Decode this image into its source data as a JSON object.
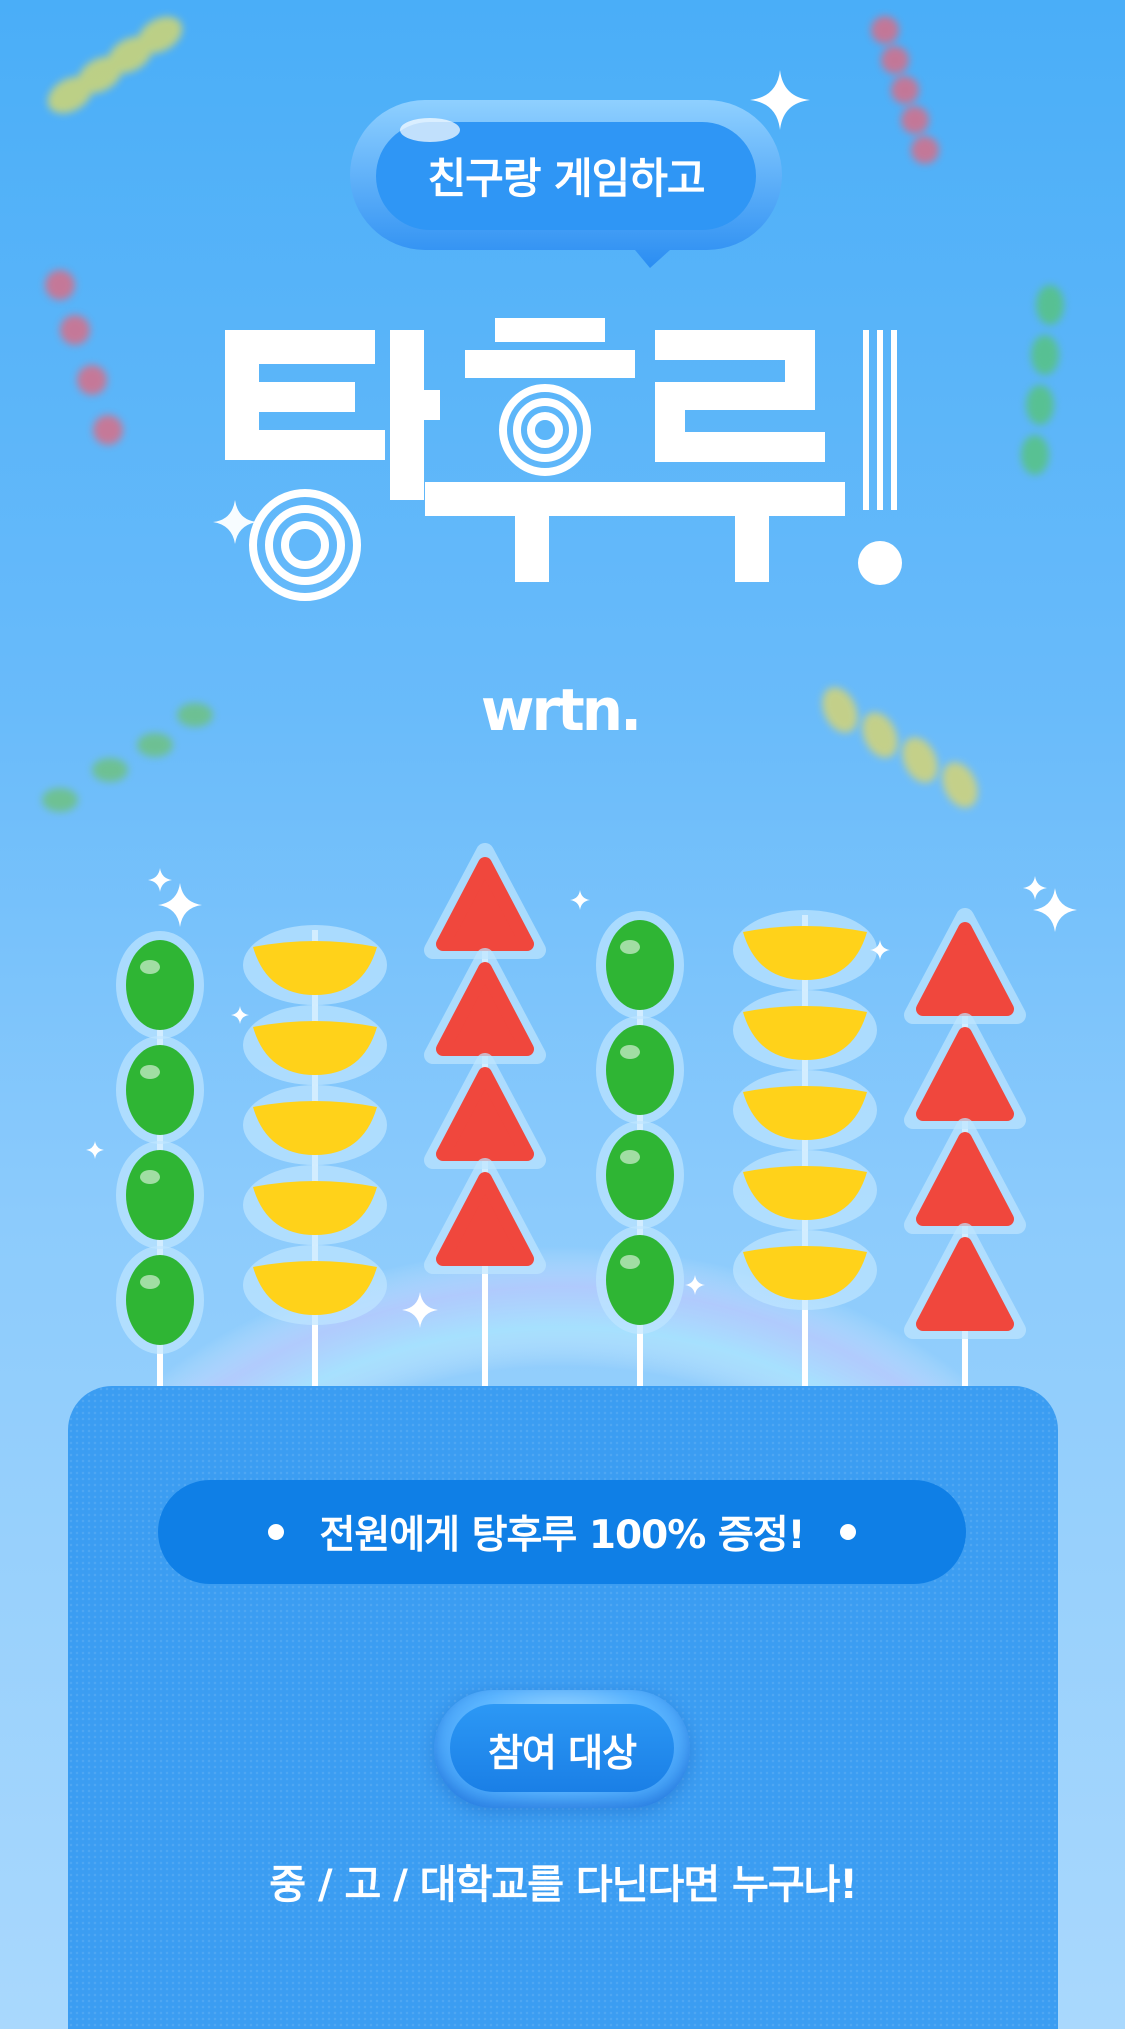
{
  "header": {
    "bubble_text": "친구랑 게임하고",
    "title": "탕후루!",
    "logo": "wrtn."
  },
  "promo": {
    "banner_text": "전원에게 탕후루 100% 증정!",
    "eligibility_label": "참여 대상",
    "eligibility_text": "중 / 고 / 대학교를 다닌다면 누구나!"
  },
  "colors": {
    "background_top": "#4aaef8",
    "panel": "#3b9df2",
    "banner": "#0f7fe6",
    "grape": "#2fb534",
    "orange": "#ffd21a",
    "strawberry": "#f0473d"
  },
  "skewers": [
    {
      "fruit": "grape",
      "count": 4
    },
    {
      "fruit": "orange",
      "count": 5
    },
    {
      "fruit": "strawberry",
      "count": 4
    },
    {
      "fruit": "grape",
      "count": 4
    },
    {
      "fruit": "orange",
      "count": 5
    },
    {
      "fruit": "strawberry",
      "count": 4
    }
  ]
}
